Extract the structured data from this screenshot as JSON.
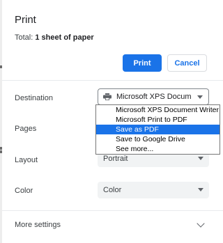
{
  "dialog": {
    "title": "Print",
    "total_label": "Total:",
    "total_value": "1 sheet of paper"
  },
  "buttons": {
    "print": "Print",
    "cancel": "Cancel"
  },
  "destination": {
    "label": "Destination",
    "selected": "Microsoft XPS Docum",
    "options": [
      "Microsoft XPS Document Writer",
      "Microsoft Print to PDF",
      "Save as PDF",
      "Save to Google Drive",
      "See more..."
    ],
    "highlighted": "Save as PDF"
  },
  "pages": {
    "label": "Pages"
  },
  "layout": {
    "label": "Layout",
    "value": "Portrait"
  },
  "color": {
    "label": "Color",
    "value": "Color"
  },
  "more_settings": {
    "label": "More settings"
  },
  "colors": {
    "accent": "#1a73e8",
    "select_bg": "#f1f3f4",
    "divider": "#e8eaed"
  },
  "icons": {
    "printer": "printer-icon",
    "dropdown": "chevron-down-icon",
    "expand": "chevron-down-icon"
  }
}
